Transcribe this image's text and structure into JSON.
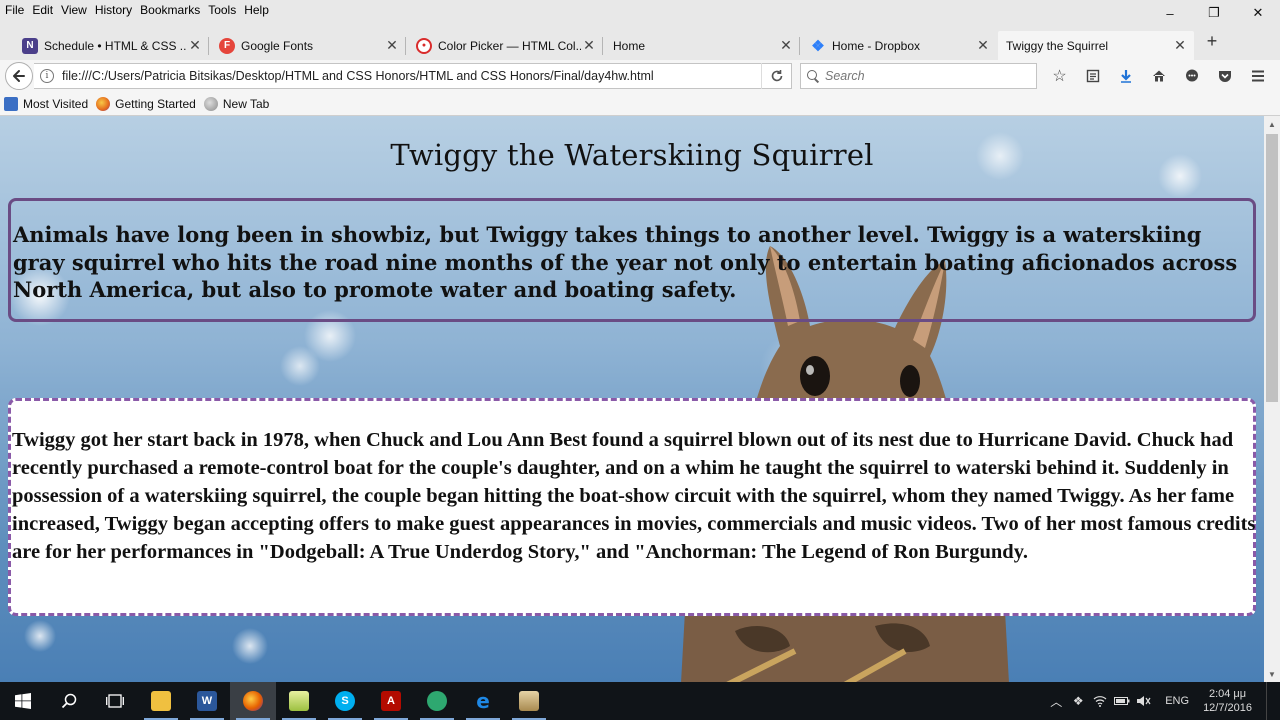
{
  "menu": [
    "File",
    "Edit",
    "View",
    "History",
    "Bookmarks",
    "Tools",
    "Help"
  ],
  "window_controls": {
    "minimize": "–",
    "maximize": "❐",
    "close": "✕"
  },
  "tabs": [
    {
      "title": "Schedule • HTML & CSS ...",
      "icon": "n-icon",
      "icon_char": "N",
      "icon_color": "#4b3f8a"
    },
    {
      "title": "Google Fonts",
      "icon": "google-fonts-icon",
      "icon_char": "F",
      "icon_color": "#e5453b"
    },
    {
      "title": "Color Picker — HTML Col...",
      "icon": "color-picker-icon",
      "icon_char": "●",
      "icon_color": "#d92c2c"
    },
    {
      "title": "Home",
      "icon": "",
      "icon_char": "",
      "icon_color": ""
    },
    {
      "title": "Home - Dropbox",
      "icon": "dropbox-icon",
      "icon_char": "❖",
      "icon_color": "#2d7ff9"
    },
    {
      "title": "Twiggy the Squirrel",
      "icon": "",
      "icon_char": "",
      "icon_color": ""
    }
  ],
  "new_tab_glyph": "+",
  "close_glyph": "✕",
  "navbar": {
    "url": "file:///C:/Users/Patricia Bitsikas/Desktop/HTML and CSS Honors/HTML and CSS Honors/Final/day4hw.html",
    "search_placeholder": "Search"
  },
  "bookmarks": [
    {
      "label": "Most Visited",
      "color": "#3b6fc4"
    },
    {
      "label": "Getting Started",
      "color": "#e56a1d"
    },
    {
      "label": "New Tab",
      "color": "#8a8a8a"
    }
  ],
  "page": {
    "title": "Twiggy the Waterskiing Squirrel",
    "intro": "Animals have long been in showbiz, but Twiggy takes things to another level. Twiggy is a waterskiing gray squirrel who hits the road nine months of the year not only to entertain boating aficionados across North America, but also to promote water and boating safety.",
    "story": "Twiggy got her start back in 1978, when Chuck and Lou Ann Best found a squirrel blown out of its nest due to Hurricane David. Chuck had recently purchased a remote-control boat for the couple's daughter, and on a whim he taught the squirrel to waterski behind it. Suddenly in possession of a waterskiing squirrel, the couple began hitting the boat-show circuit with the squirrel, whom they named Twiggy. As her fame increased, Twiggy began accepting offers to make guest appearances in movies, commercials and music videos. Two of her most famous credits are for her performances in \"Dodgeball: A True Underdog Story,\" and \"Anchorman: The Legend of Ron Burgundy."
  },
  "taskbar": {
    "apps": [
      {
        "name": "file-explorer",
        "label": "",
        "color": "#f0c040"
      },
      {
        "name": "word",
        "label": "W",
        "color": "#2b579a"
      },
      {
        "name": "firefox",
        "label": "",
        "color": "#e66000"
      },
      {
        "name": "folder",
        "label": "",
        "color": "#c8d850"
      },
      {
        "name": "skype",
        "label": "S",
        "color": "#00aff0"
      },
      {
        "name": "acrobat",
        "label": "A",
        "color": "#b30b00"
      },
      {
        "name": "globe-app",
        "label": "",
        "color": "#2ea870"
      },
      {
        "name": "edge",
        "label": "e",
        "color": "#1e88e5"
      },
      {
        "name": "archive",
        "label": "",
        "color": "#c9a96a"
      }
    ],
    "language": "ENG",
    "time": "2:04 μμ",
    "date": "12/7/2016"
  }
}
